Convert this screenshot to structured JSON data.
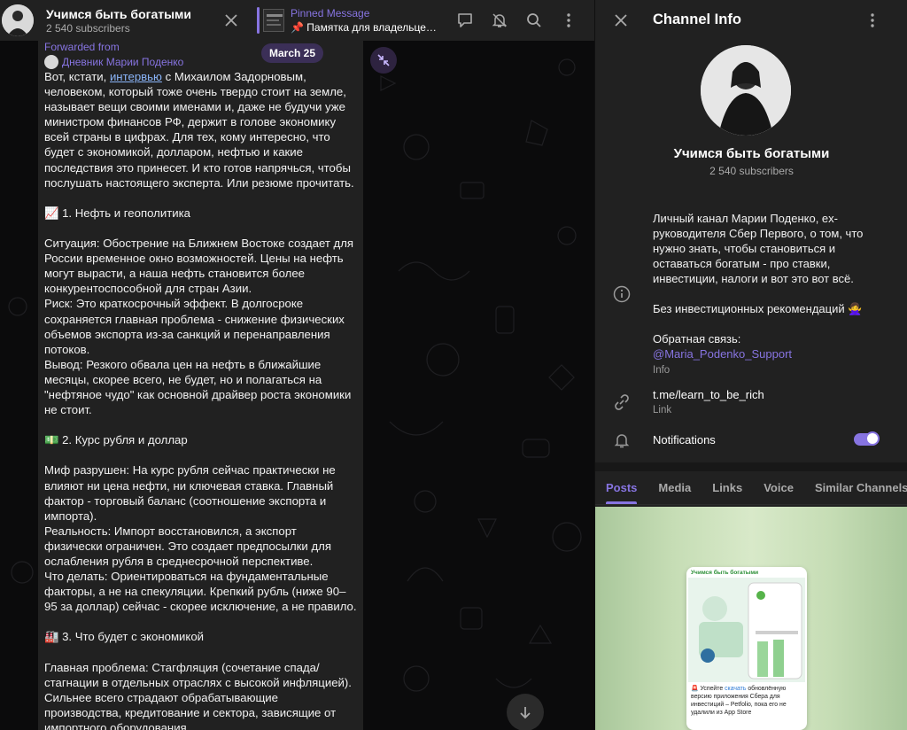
{
  "header": {
    "channel_name": "Учимся быть богатыми",
    "subscribers": "2 540 subscribers",
    "pinned_label": "Pinned Message",
    "pinned_text": "📌 Памятка для владельцев ..."
  },
  "chat": {
    "date_pill": "March 25",
    "forwarded_label": "Forwarded from",
    "forwarded_author": "Дневник Марии Поденко",
    "message": {
      "intro_before_link": "Вот, кстати, ",
      "link_text": "интервью",
      "intro_after_link": " с Михаилом Задорновым,\nчеловеком, который тоже очень твердо стоит на земле,\nназывает вещи своими именами и, даже не будучи уже\nминистром финансов РФ, держит в голове экономику\nвсей страны в цифрах. Для тех, кому интересно, что\nбудет с экономикой, долларом, нефтью и какие\nпоследствия это принесет. И кто готов напрячься, чтобы\nпослушать настоящего эксперта. Или резюме прочитать.",
      "body": "\n\n📈 1. Нефть и геополитика\n\nСитуация: Обострение на Ближнем Востоке создает для\nРоссии временное окно возможностей. Цены на нефть\nмогут вырасти, а наша нефть становится более\nконкурентоспособной для стран Азии.\nРиск: Это краткосрочный эффект. В долгосроке\nсохраняется главная проблема - снижение физических\nобъемов экспорта из-за санкций и перенаправления\nпотоков.\nВывод: Резкого обвала цен на нефть в ближайшие\nмесяцы, скорее всего, не будет, но и полагаться на\n\"нефтяное чудо\" как основной драйвер роста экономики\nне стоит.\n\n💵 2. Курс рубля и доллар\n\nМиф разрушен: На курс рубля сейчас практически не\nвлияют ни цена нефти, ни ключевая ставка. Главный\nфактор - торговый баланс (соотношение экспорта и\nимпорта).\nРеальность: Импорт восстановился, а экспорт\nфизически ограничен. Это создает предпосылки для\nослабления рубля в среднесрочной перспективе.\nЧто делать: Ориентироваться на фундаментальные\nфакторы, а не на спекуляции. Крепкий рубль (ниже 90–\n95 за доллар) сейчас - скорее исключение, а не правило.\n\n🏭 3. Что будет с экономикой\n\nГлавная проблема: Стагфляция (сочетание спада/\nстагнации в отдельных отраслях с высокой инфляцией).\nСильнее всего страдают обрабатывающие\nпроизводства, кредитование и сектора, зависящие от\nимпортного оборудования"
    }
  },
  "panel": {
    "title": "Channel Info",
    "channel_name": "Учимся быть богатыми",
    "subscribers": "2 540 subscribers",
    "description": "Личный канал Марии Поденко, ex-\nруководителя Сбер Первого, о том, что\nнужно знать, чтобы становиться и\nоставаться богатым - про ставки,\nинвестиции, налоги и вот это вот всё.\n\nБез инвестиционных рекомендаций 🙅‍♀️\n\nОбратная связь:\n",
    "mention": "@Maria_Podenko_Support",
    "info_label": "Info",
    "link": "t.me/learn_to_be_rich",
    "link_label": "Link",
    "notifications_label": "Notifications",
    "notifications_on": true,
    "tabs": [
      "Posts",
      "Media",
      "Links",
      "Voice",
      "Similar Channels"
    ],
    "active_tab": "Posts",
    "post_preview": {
      "card_header": "Учимся быть богатыми",
      "card_text_before": "🚨 Успейте ",
      "card_text_link": "скачать",
      "card_text_after": " обновлённую версию приложения Сбера для инвестиций – Petfolio, пока его не удалили из App Store"
    }
  },
  "colors": {
    "accent": "#8774e1",
    "bubble": "#212121",
    "panel_bg": "#212121",
    "chat_bg": "#0b0b0c"
  }
}
